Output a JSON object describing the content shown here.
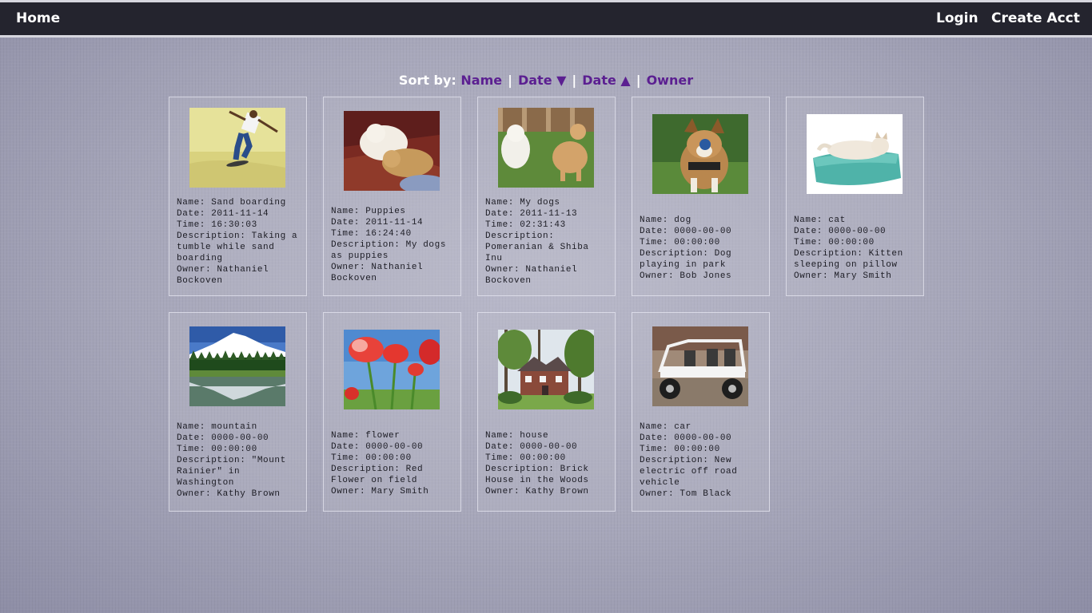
{
  "nav": {
    "home": "Home",
    "login": "Login",
    "create_account": "Create Acct"
  },
  "sort": {
    "label": "Sort by:",
    "name": "Name",
    "date_desc": "Date ▼",
    "date_asc": "Date ▲",
    "owner": "Owner",
    "separator": "|"
  },
  "labels": {
    "name": "Name:",
    "date": "Date:",
    "time": "Time:",
    "description": "Description:",
    "owner": "Owner:"
  },
  "photos": [
    {
      "name": "Sand boarding",
      "date": "2011-11-14",
      "time": "16:30:03",
      "description": "Taking a tumble while sand boarding",
      "owner": "Nathaniel Bockoven",
      "image": "sand-boarding-photo"
    },
    {
      "name": "Puppies",
      "date": "2011-11-14",
      "time": "16:24:40",
      "description": "My dogs as puppies",
      "owner": "Nathaniel Bockoven",
      "image": "puppies-photo"
    },
    {
      "name": "My dogs",
      "date": "2011-11-13",
      "time": "02:31:43",
      "description": "Pomeranian & Shiba Inu",
      "owner": "Nathaniel Bockoven",
      "image": "dogs-photo"
    },
    {
      "name": "dog",
      "date": "0000-00-00",
      "time": "00:00:00",
      "description": "Dog playing in park",
      "owner": "Bob Jones",
      "image": "dog-photo"
    },
    {
      "name": "cat",
      "date": "0000-00-00",
      "time": "00:00:00",
      "description": "Kitten sleeping on pillow",
      "owner": "Mary Smith",
      "image": "cat-photo"
    },
    {
      "name": "mountain",
      "date": "0000-00-00",
      "time": "00:00:00",
      "description": "\"Mount Rainier\" in Washington",
      "owner": "Kathy Brown",
      "image": "mountain-photo"
    },
    {
      "name": "flower",
      "date": "0000-00-00",
      "time": "00:00:00",
      "description": "Red Flower on field",
      "owner": "Mary Smith",
      "image": "flower-photo"
    },
    {
      "name": "house",
      "date": "0000-00-00",
      "time": "00:00:00",
      "description": "Brick House in the Woods",
      "owner": "Kathy Brown",
      "image": "house-photo"
    },
    {
      "name": "car",
      "date": "0000-00-00",
      "time": "00:00:00",
      "description": "New electric off road vehicle",
      "owner": "Tom Black",
      "image": "car-photo"
    }
  ]
}
